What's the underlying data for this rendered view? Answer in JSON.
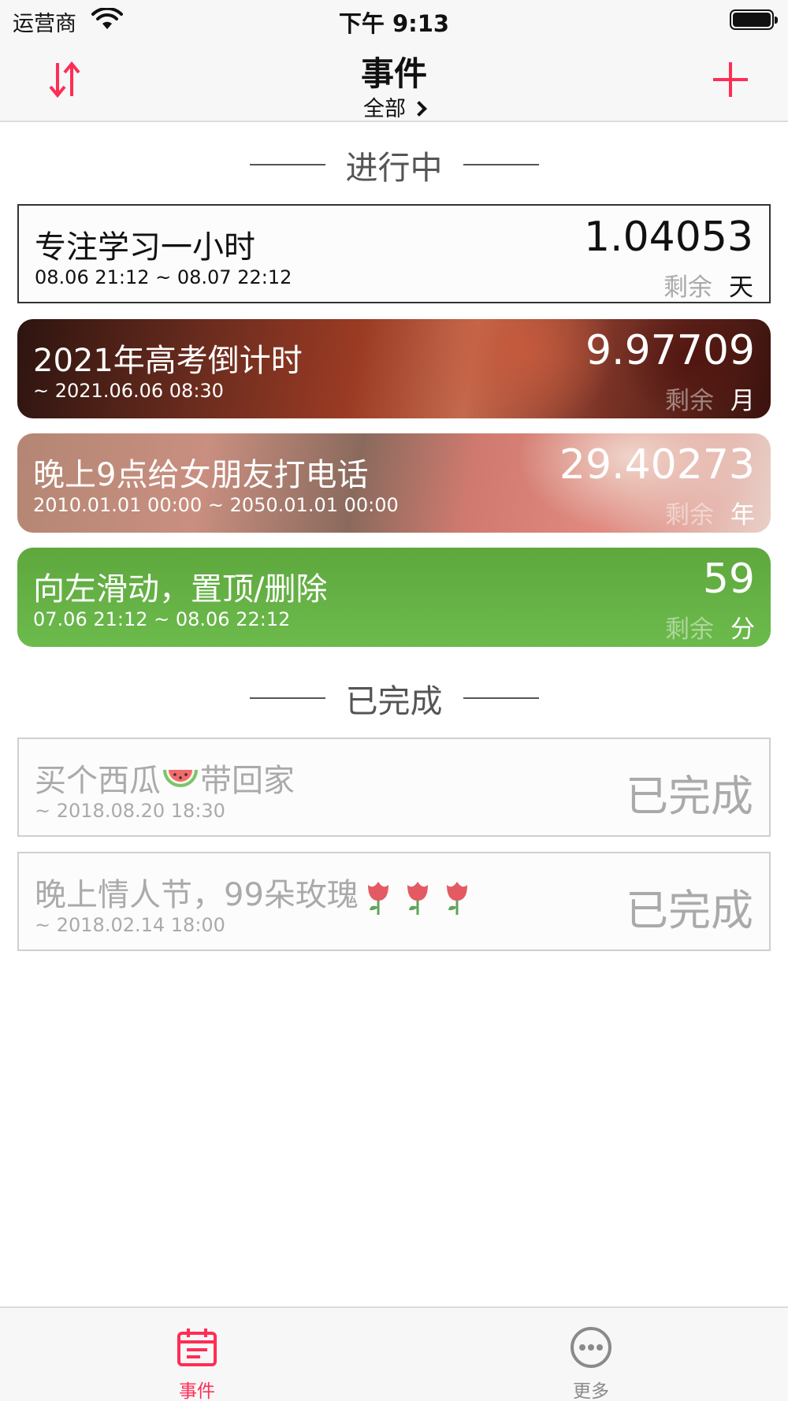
{
  "status_bar": {
    "carrier": "运营商",
    "time": "下午 9:13"
  },
  "nav": {
    "title": "事件",
    "subtitle": "全部"
  },
  "sections": {
    "in_progress": "进行中",
    "completed": "已完成"
  },
  "active_events": [
    {
      "title": "专注学习一小时",
      "time": "08.06 21:12 ~ 08.07 22:12",
      "value": "1.04053",
      "remain": "剩余",
      "unit": "天"
    },
    {
      "title": "2021年高考倒计时",
      "time": "~ 2021.06.06 08:30",
      "value": "9.97709",
      "remain": "剩余",
      "unit": "月"
    },
    {
      "title": "晚上9点给女朋友打电话",
      "time": "2010.01.01 00:00 ~ 2050.01.01 00:00",
      "value": "29.40273",
      "remain": "剩余",
      "unit": "年"
    },
    {
      "title": "向左滑动，置顶/删除",
      "time": "07.06 21:12 ~ 08.06 22:12",
      "value": "59",
      "remain": "剩余",
      "unit": "分"
    }
  ],
  "completed_events": [
    {
      "title_before": "买个西瓜",
      "title_after": "带回家",
      "time": "~ 2018.08.20 18:30",
      "status": "已完成"
    },
    {
      "title_before": "晚上情人节，99朵玫瑰",
      "title_after": "",
      "time": "~ 2018.02.14 18:00",
      "status": "已完成"
    }
  ],
  "tabs": {
    "events": "事件",
    "more": "更多"
  },
  "colors": {
    "accent": "#ff2d55",
    "green": "#6cba4c",
    "muted": "#aaaaaa"
  },
  "icons": {
    "sort": "sort-arrows-icon",
    "add": "plus-icon",
    "events_tab": "calendar-icon",
    "more_tab": "ellipsis-circle-icon",
    "watermelon": "watermelon-emoji",
    "rose": "rose-emoji"
  }
}
